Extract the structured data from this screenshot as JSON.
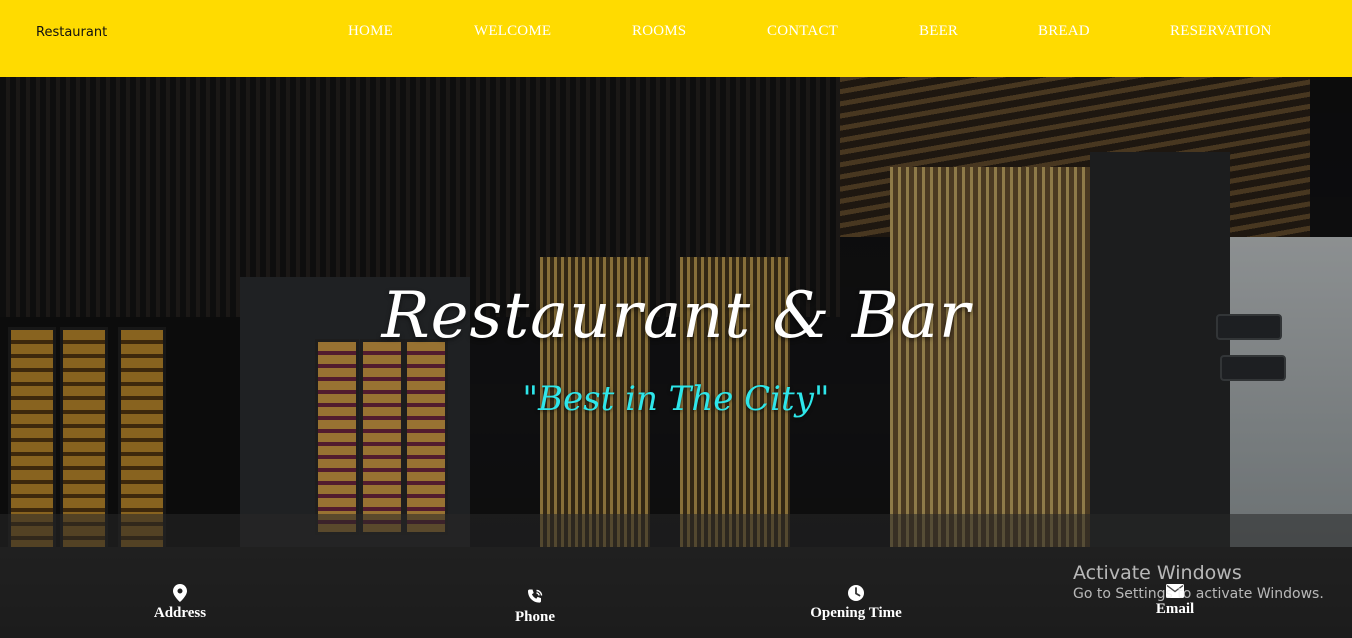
{
  "header": {
    "brand": "Restaurant",
    "nav": [
      {
        "label": "HOME"
      },
      {
        "label": "WELCOME"
      },
      {
        "label": "ROOMS"
      },
      {
        "label": "CONTACT"
      },
      {
        "label": "BEER"
      },
      {
        "label": "BREAD"
      },
      {
        "label": "RESERVATION"
      }
    ]
  },
  "hero": {
    "title": "Restaurant & Bar",
    "subtitle": "\"Best in The City\""
  },
  "info": [
    {
      "label": "Address",
      "icon": "location-pin-icon"
    },
    {
      "label": "Phone",
      "icon": "phone-icon"
    },
    {
      "label": "Opening Time",
      "icon": "clock-icon"
    },
    {
      "label": "Email",
      "icon": "envelope-icon"
    }
  ],
  "watermark": {
    "line1": "Activate Windows",
    "line2": "Go to Settings to activate Windows."
  },
  "colors": {
    "header_bg": "#ffdb00",
    "subtitle": "#2ee6ea",
    "nav_text": "#ffffff"
  }
}
